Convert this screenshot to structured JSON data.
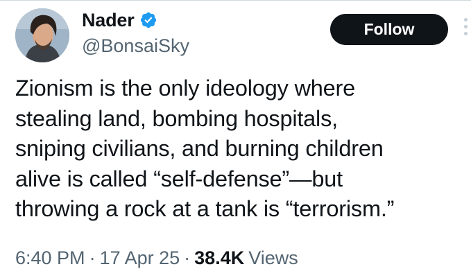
{
  "author": {
    "display_name": "Nader",
    "handle": "@BonsaiSky",
    "verified": true
  },
  "follow_button": {
    "label": "Follow"
  },
  "tweet": {
    "lines": [
      "Zionism is the only ideology where",
      "stealing land, bombing hospitals,",
      "sniping civilians, and burning children",
      "alive is called “self-defense”—but",
      "throwing a rock at a tank is “terrorism.”"
    ]
  },
  "meta": {
    "time": "6:40 PM",
    "separator": "·",
    "date": "17 Apr 25",
    "views_count": "38.4K",
    "views_label": "Views"
  },
  "icons": {
    "verified": "verified-badge-icon",
    "more": "more-options-icon"
  },
  "colors": {
    "accent_blue": "#1d9bf0",
    "text_primary": "#0f1419",
    "text_secondary": "#536471",
    "button_bg": "#0f1419",
    "button_text": "#ffffff"
  }
}
